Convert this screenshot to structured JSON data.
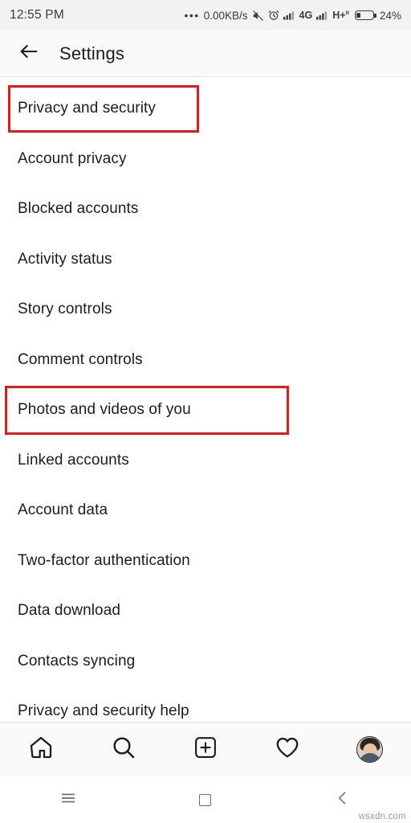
{
  "status_bar": {
    "time": "12:55 PM",
    "overflow_dots": "•••",
    "data_rate": "0.00KB/s",
    "icons": [
      "mute-icon",
      "alarm-icon",
      "signal-1-icon",
      "network-4g-icon",
      "signal-2-icon",
      "network-h-plus-icon"
    ],
    "network_4g": "4G",
    "network_h": "H+",
    "network_h_sup": "ıı",
    "battery_percent": "24%"
  },
  "app_bar": {
    "back_icon": "arrow-left-icon",
    "title": "Settings"
  },
  "list": {
    "items": [
      {
        "label": "Privacy and security",
        "highlight": "a"
      },
      {
        "label": "Account privacy",
        "highlight": ""
      },
      {
        "label": "Blocked accounts",
        "highlight": ""
      },
      {
        "label": "Activity status",
        "highlight": ""
      },
      {
        "label": "Story controls",
        "highlight": ""
      },
      {
        "label": "Comment controls",
        "highlight": ""
      },
      {
        "label": "Photos and videos of you",
        "highlight": "b"
      },
      {
        "label": "Linked accounts",
        "highlight": ""
      },
      {
        "label": "Account data",
        "highlight": ""
      },
      {
        "label": "Two-factor authentication",
        "highlight": ""
      },
      {
        "label": "Data download",
        "highlight": ""
      },
      {
        "label": "Contacts syncing",
        "highlight": ""
      },
      {
        "label": "Privacy and security help",
        "highlight": ""
      }
    ],
    "highlight_color": "#e01b1b"
  },
  "bottom_nav": {
    "items": [
      {
        "name": "home-icon"
      },
      {
        "name": "search-icon"
      },
      {
        "name": "add-post-icon"
      },
      {
        "name": "heart-icon"
      },
      {
        "name": "profile-avatar"
      }
    ]
  },
  "system_nav": {
    "menu_icon": "menu-icon",
    "home_icon": "square-home-icon",
    "back_icon": "chevron-left-icon"
  },
  "watermark": "wsxdn.com"
}
